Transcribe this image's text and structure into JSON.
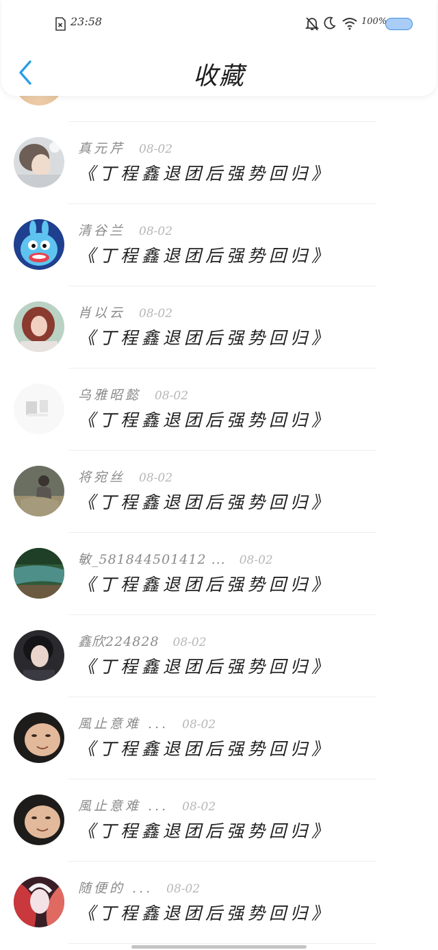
{
  "status_bar": {
    "time": "23:58",
    "battery_percent": "100%",
    "icons": [
      "sim-off-icon",
      "mute-bell-icon",
      "moon-icon",
      "wifi-icon"
    ],
    "battery_color": "#a9cdf7"
  },
  "header": {
    "title": "收藏",
    "back_icon": "chevron-left-icon",
    "accent_color": "#2a9de8"
  },
  "favorites": [
    {
      "user": "",
      "date": "",
      "title": "",
      "avatar": "avatar-partial"
    },
    {
      "user": "真元芹",
      "date": "08-02",
      "title": "《丁程鑫退团后强势回归》",
      "avatar": "avatar-girl-light"
    },
    {
      "user": "清谷兰",
      "date": "08-02",
      "title": "《丁程鑫退团后强势回归》",
      "avatar": "avatar-cartoon-blue"
    },
    {
      "user": "肖以云",
      "date": "08-02",
      "title": "《丁程鑫退团后强势回归》",
      "avatar": "avatar-girl-red-hair"
    },
    {
      "user": "乌雅昭懿",
      "date": "08-02",
      "title": "《丁程鑫退团后强势回归》",
      "avatar": "avatar-faded-white"
    },
    {
      "user": "将宛丝",
      "date": "08-02",
      "title": "《丁程鑫退团后强势回归》",
      "avatar": "avatar-person-field"
    },
    {
      "user": "敏_581844501412 ...",
      "date": "08-02",
      "title": "《丁程鑫退团后强势回归》",
      "avatar": "avatar-river-landscape"
    },
    {
      "user": "鑫欣224828",
      "date": "08-02",
      "title": "《丁程鑫退团后强势回归》",
      "avatar": "avatar-boy-dark"
    },
    {
      "user": "風止意难 ...",
      "date": "08-02",
      "title": "《丁程鑫退团后强势回归》",
      "avatar": "avatar-face-closeup"
    },
    {
      "user": "風止意难 ...",
      "date": "08-02",
      "title": "《丁程鑫退团后强势回归》",
      "avatar": "avatar-face-closeup"
    },
    {
      "user": "随便的 ...",
      "date": "08-02",
      "title": "《丁程鑫退团后强势回归》",
      "avatar": "avatar-anime-red"
    }
  ]
}
